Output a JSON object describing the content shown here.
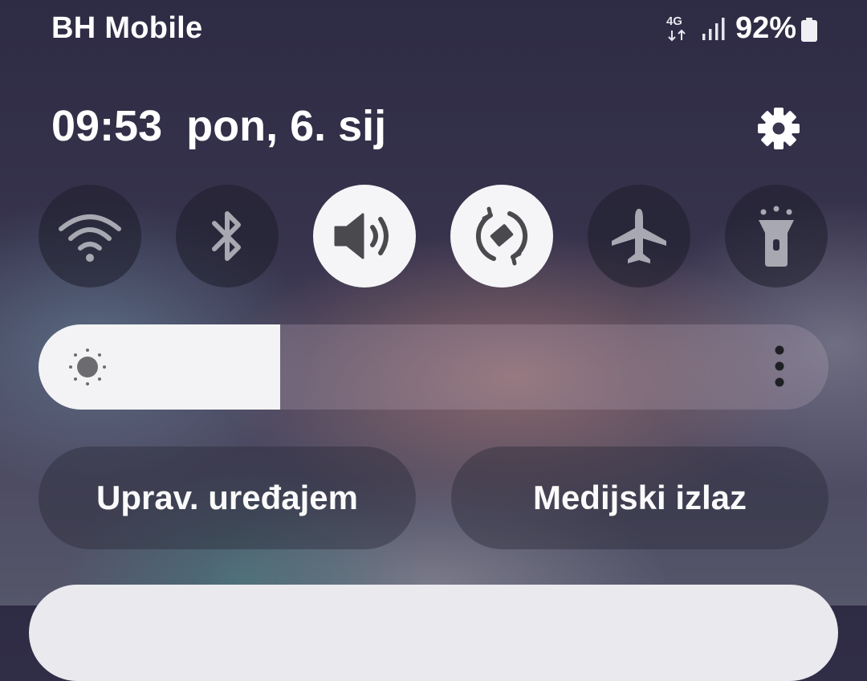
{
  "status_bar": {
    "carrier": "BH Mobile",
    "network_type": "4G",
    "battery_percent": "92%",
    "signal_strength_bars": 4
  },
  "header": {
    "time": "09:53",
    "date": "pon, 6. sij",
    "settings_icon": "gear-icon"
  },
  "quick_tiles": [
    {
      "icon": "wifi-icon",
      "active": false
    },
    {
      "icon": "bluetooth-icon",
      "active": false
    },
    {
      "icon": "sound-icon",
      "active": true
    },
    {
      "icon": "auto-rotate-icon",
      "active": true
    },
    {
      "icon": "airplane-icon",
      "active": false
    },
    {
      "icon": "flashlight-icon",
      "active": false
    }
  ],
  "brightness": {
    "level": 0.306,
    "icon": "sun-icon",
    "menu_icon": "more-vertical-icon"
  },
  "buttons": {
    "device_control": "Uprav. uređajem",
    "media_output": "Medijski izlaz"
  },
  "colors": {
    "tile_active_bg": "#f5f5f7",
    "tile_inactive_bg": "#2a2a3a",
    "icon_active": "#4a4a4e",
    "icon_inactive": "#a8a8b2"
  }
}
